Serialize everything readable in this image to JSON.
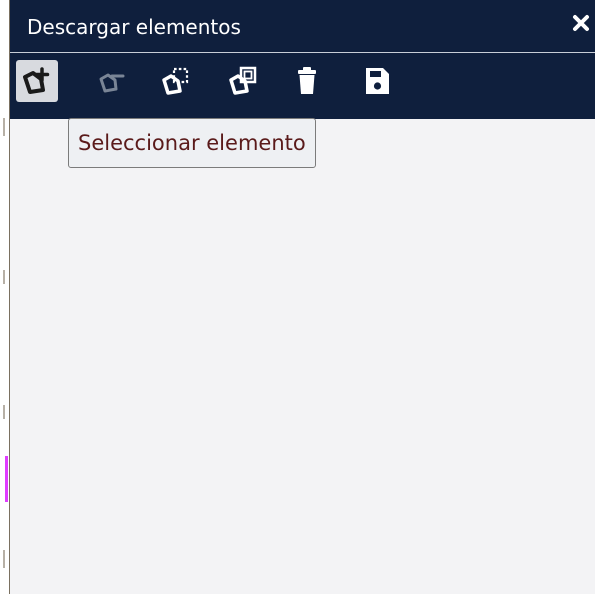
{
  "window": {
    "title": "Descargar elementos",
    "close_icon": "close-icon"
  },
  "toolbar": {
    "tools": [
      {
        "name": "select-element-tool",
        "icon": "polygon-plus-icon",
        "active": true
      },
      {
        "name": "deselect-element-tool",
        "icon": "polygon-minus-icon",
        "active": false,
        "disabled": true
      },
      {
        "name": "select-by-area-tool",
        "icon": "polygon-dashed-square-icon",
        "active": false
      },
      {
        "name": "select-by-polygon-tool",
        "icon": "polygon-square-icon",
        "active": false
      },
      {
        "name": "delete-tool",
        "icon": "trash-icon",
        "active": false
      },
      {
        "name": "save-tool",
        "icon": "floppy-disk-icon",
        "active": false
      }
    ]
  },
  "tooltip": {
    "text": "Seleccionar elemento"
  },
  "colors": {
    "header_bg": "#0f1f3d",
    "panel_bg": "#f3f3f5",
    "active_tool_bg": "#d8dadf",
    "tooltip_text": "#5a1a1a",
    "disabled_icon": "#7a8596",
    "accent_pink": "#e03cff"
  }
}
